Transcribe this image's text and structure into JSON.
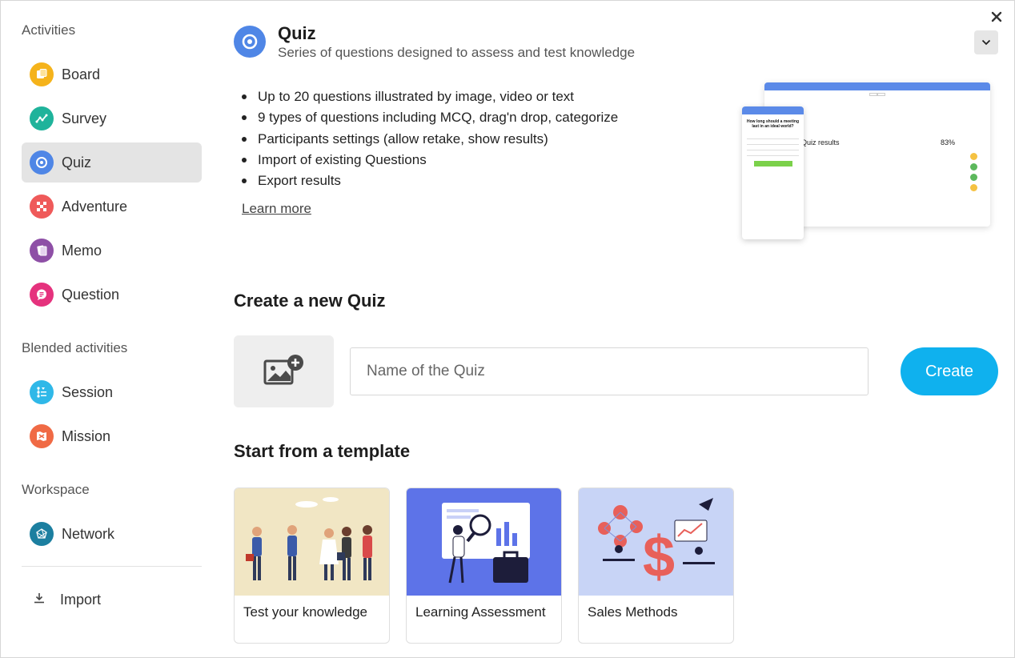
{
  "sidebar": {
    "sections": {
      "activities": "Activities",
      "blended": "Blended activities",
      "workspace": "Workspace"
    },
    "items": [
      {
        "label": "Board",
        "icon": "board-icon",
        "color": "#f5b31b"
      },
      {
        "label": "Survey",
        "icon": "survey-icon",
        "color": "#1fb39b"
      },
      {
        "label": "Quiz",
        "icon": "quiz-icon",
        "color": "#4f86e6"
      },
      {
        "label": "Adventure",
        "icon": "adventure-icon",
        "color": "#ef5a5a"
      },
      {
        "label": "Memo",
        "icon": "memo-icon",
        "color": "#8e4fa6"
      },
      {
        "label": "Question",
        "icon": "question-icon",
        "color": "#e5327d"
      },
      {
        "label": "Session",
        "icon": "session-icon",
        "color": "#2fb8e8"
      },
      {
        "label": "Mission",
        "icon": "mission-icon",
        "color": "#f06a45"
      },
      {
        "label": "Network",
        "icon": "network-icon",
        "color": "#1c7fa0"
      }
    ],
    "import_label": "Import"
  },
  "header": {
    "title": "Quiz",
    "subtitle": "Series of questions designed to assess and test knowledge"
  },
  "features": [
    "Up to 20 questions illustrated by image, video or text",
    "9 types of questions including MCQ, drag'n drop, categorize",
    "Participants settings (allow retake, show results)",
    "Import of existing Questions",
    "Export results"
  ],
  "learn_more": "Learn more",
  "preview": {
    "results_title": "Quiz results",
    "results_pct": "83%",
    "mobile_question": "How long should a meeting last in an ideal world?"
  },
  "create": {
    "title": "Create a new Quiz",
    "name_placeholder": "Name of the Quiz",
    "button_label": "Create"
  },
  "templates": {
    "title": "Start from a template",
    "items": [
      {
        "label": "Test your knowledge",
        "bg": "#f1e6c4"
      },
      {
        "label": "Learning Assessment",
        "bg": "#5d73e8"
      },
      {
        "label": "Sales Methods",
        "bg": "#c8d4f6"
      }
    ]
  },
  "colors": {
    "accent": "#0fb1ee",
    "active_nav": "#e4e4e4"
  }
}
